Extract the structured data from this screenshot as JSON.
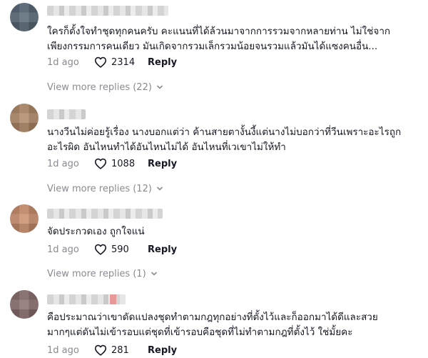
{
  "comments": [
    {
      "text": "ใครก็ตั้งใจทำชุดทุกคนครับ คะแนนที่ได้ล้วนมาจากการรวมจากหลายท่าน ไม่ใช่จาก\nเพียงกรรมการคนเดียว มันเกิดจากรวมเล็กรวมน้อยจนรวมแล้วมันได้แซงคนอื่น...",
      "time": "1d ago",
      "likes": "2314",
      "reply": "Reply",
      "more": "View more replies (22)",
      "avatar_color": "#5a6a78",
      "name_width": 170,
      "name_accent": false
    },
    {
      "text": "นางวีนไม่ค่อยรู้เรื่อง นางบอกแต่ว่า ค้านสายตางั้นงี้แต่นางไม่บอกว่าที่วีนเพราะอะไรถูก\nอะไรผิด อันไหนทำได้อันไหนไม่ได้ อันไหนที่เวเขาไม่ให้ทำ",
      "time": "1d ago",
      "likes": "1088",
      "reply": "Reply",
      "more": "View more replies (12)",
      "avatar_color": "#b08a6a",
      "name_width": 54,
      "name_accent": false
    },
    {
      "text": "จัดประกวดเอง ถูกใจแน่",
      "time": "1d ago",
      "likes": "590",
      "reply": "Reply",
      "more": "View more replies (1)",
      "avatar_color": "#c98f6e",
      "name_width": 162,
      "name_accent": false
    },
    {
      "text": "คือประมาณว่าเขาดัดแปลงชุดทำตามกฎทุกอย่างที่ตั้งไว้และก็ออกมาได้ดีและสวย\nมากๆแต่ดันไม่เข้ารอบแต่ชุดที่เข้ารอบคือชุดที่ไม่ทำตามกฎที่ตั้งไว้ ใช่มั้ยคะ",
      "time": "1d ago",
      "likes": "281",
      "reply": "Reply",
      "more": "",
      "avatar_color": "#8a7070",
      "name_width": 110,
      "name_accent": true
    }
  ]
}
